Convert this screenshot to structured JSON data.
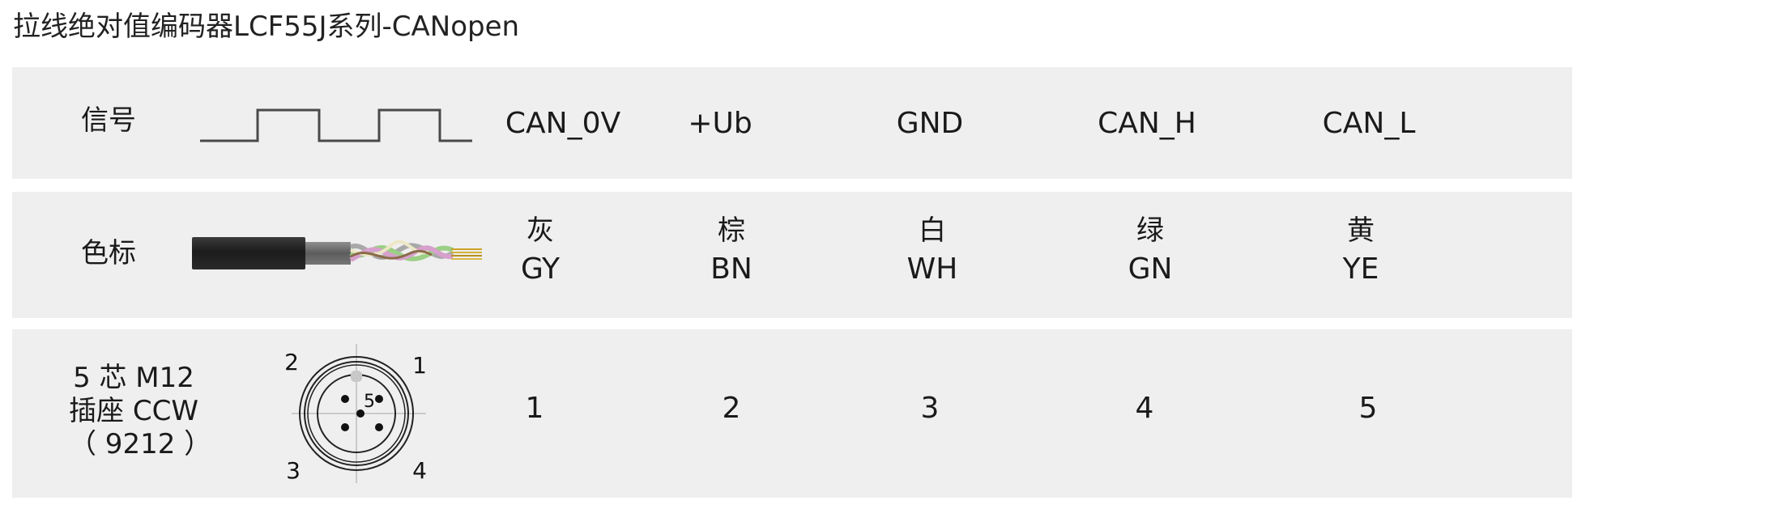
{
  "title": "拉线绝对值编码器LCF55J系列-CANopen",
  "rows": {
    "signal": {
      "label": "信号",
      "cells": [
        "CAN_0V",
        "+Ub",
        "GND",
        "CAN_H",
        "CAN_L"
      ]
    },
    "color": {
      "label": "色标",
      "cells": [
        {
          "cn": "灰",
          "en": "GY"
        },
        {
          "cn": "棕",
          "en": "BN"
        },
        {
          "cn": "白",
          "en": "WH"
        },
        {
          "cn": "绿",
          "en": "GN"
        },
        {
          "cn": "黄",
          "en": "YE"
        }
      ]
    },
    "pin": {
      "label_lines": [
        "5 芯 M12",
        "插座 CCW",
        "（ 9212 ）"
      ],
      "cells": [
        "1",
        "2",
        "3",
        "4",
        "5"
      ],
      "connector_labels": [
        "1",
        "2",
        "3",
        "4",
        "5"
      ]
    }
  }
}
